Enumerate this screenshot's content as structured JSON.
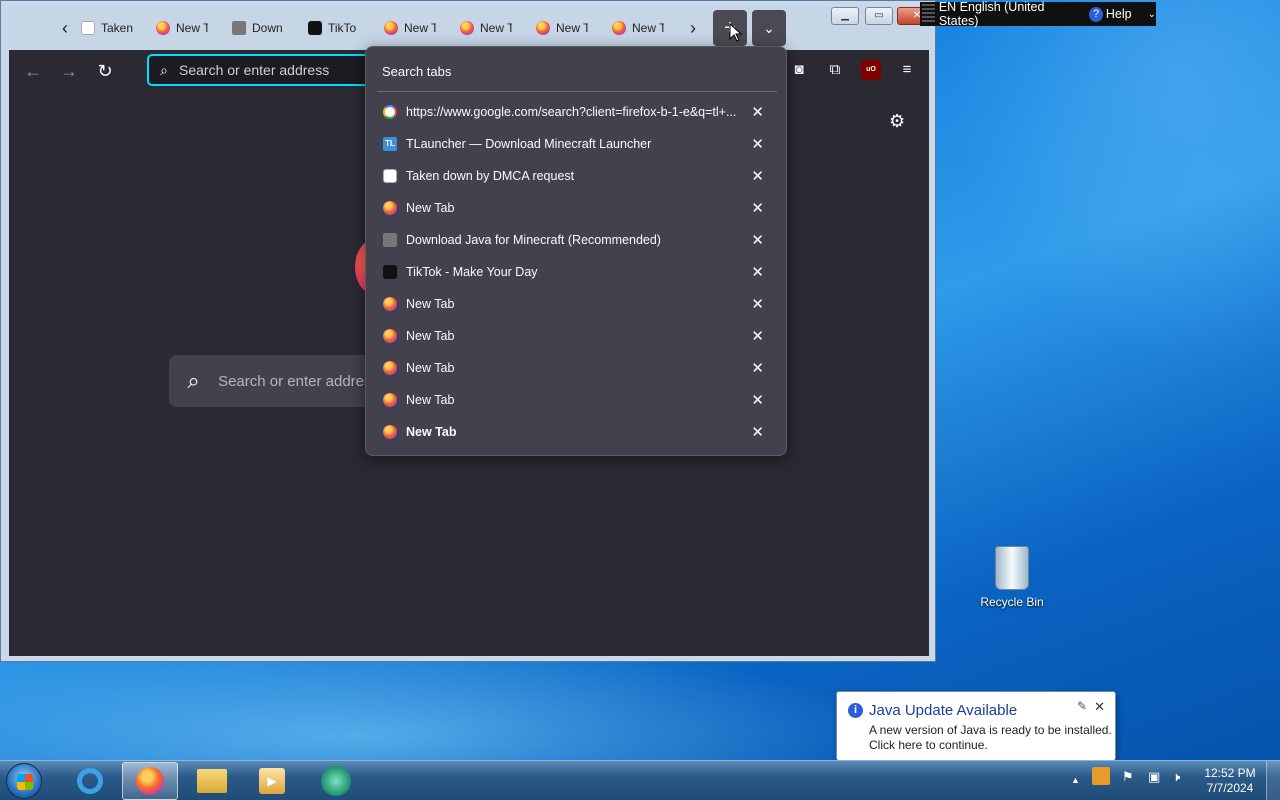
{
  "browser": {
    "tabs": [
      {
        "label": "Taken",
        "icon": "shield-icon"
      },
      {
        "label": "New T",
        "icon": "firefox-icon"
      },
      {
        "label": "Down",
        "icon": "box-icon"
      },
      {
        "label": "TikTo",
        "icon": "tiktok-icon"
      },
      {
        "label": "New T",
        "icon": "firefox-icon"
      },
      {
        "label": "New T",
        "icon": "firefox-icon"
      },
      {
        "label": "New T",
        "icon": "firefox-icon"
      },
      {
        "label": "New T",
        "icon": "firefox-icon"
      }
    ],
    "urlbar_placeholder": "Search or enter address",
    "newtab_search_placeholder": "Search or enter address",
    "accent_color": "#00ddff"
  },
  "tab_list": {
    "title": "Search tabs",
    "items": [
      {
        "label": "https://www.google.com/search?client=firefox-b-1-e&q=tl+...",
        "icon": "google-icon"
      },
      {
        "label": "TLauncher — Download Minecraft Launcher",
        "icon": "tlauncher-icon"
      },
      {
        "label": "Taken down by DMCA request",
        "icon": "shield-icon"
      },
      {
        "label": "New Tab",
        "icon": "firefox-icon"
      },
      {
        "label": "Download Java for Minecraft (Recommended)",
        "icon": "box-icon"
      },
      {
        "label": "TikTok - Make Your Day",
        "icon": "tiktok-icon"
      },
      {
        "label": "New Tab",
        "icon": "firefox-icon"
      },
      {
        "label": "New Tab",
        "icon": "firefox-icon"
      },
      {
        "label": "New Tab",
        "icon": "firefox-icon"
      },
      {
        "label": "New Tab",
        "icon": "firefox-icon"
      },
      {
        "label": "New Tab",
        "icon": "firefox-icon",
        "selected": true
      }
    ]
  },
  "ime": {
    "language": "EN English (United States)",
    "help": "Help"
  },
  "desktop": {
    "recycle_bin": "Recycle Bin"
  },
  "notification": {
    "title": "Java Update Available",
    "line1": "A new version of Java is ready to be installed.",
    "line2": "Click here to continue."
  },
  "taskbar": {
    "time": "12:52 PM",
    "date": "7/7/2024"
  }
}
